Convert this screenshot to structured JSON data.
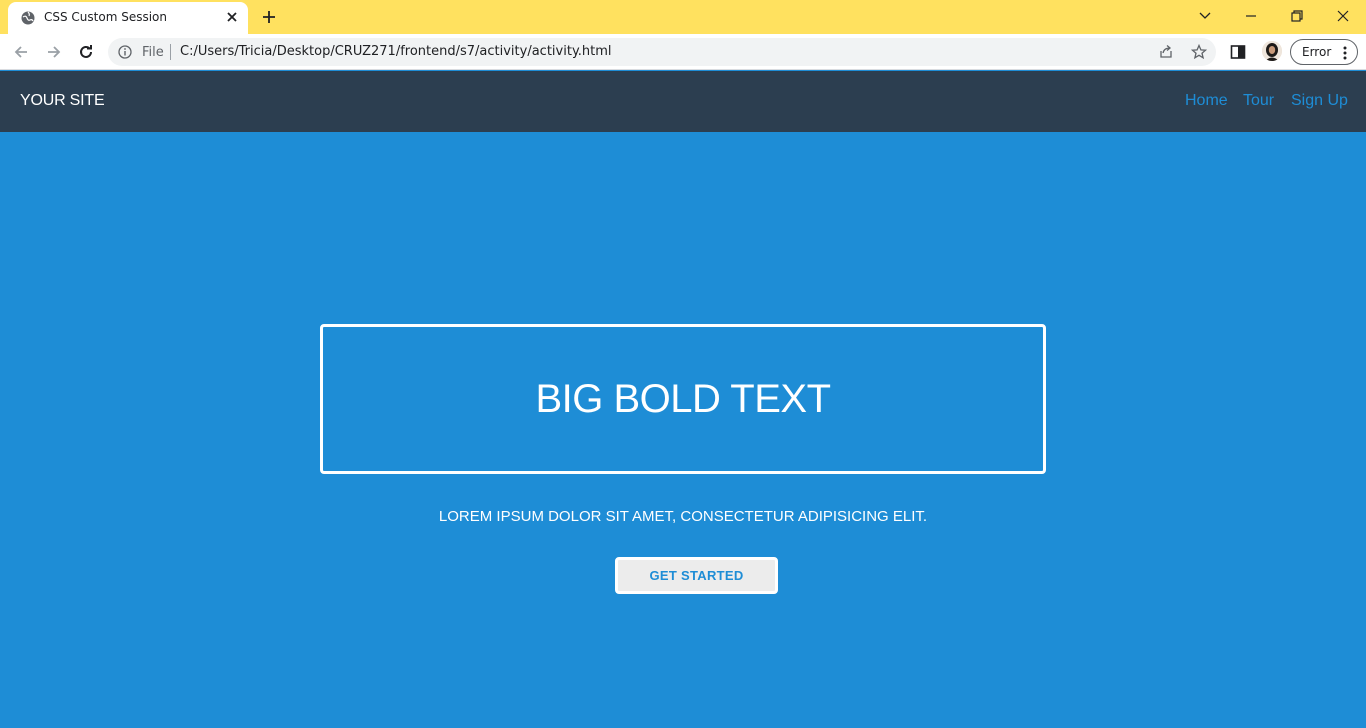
{
  "browser": {
    "tab_title": "CSS Custom Session",
    "scheme_label": "File",
    "url": "C:/Users/Tricia/Desktop/CRUZ271/frontend/s7/activity/activity.html",
    "profile_label": "Error",
    "icons": [
      "globe-icon",
      "close-icon",
      "plus-icon",
      "chevron-down-icon",
      "minimize-icon",
      "restore-icon",
      "close-window-icon",
      "back-icon",
      "forward-icon",
      "reload-icon",
      "info-icon",
      "share-icon",
      "star-icon",
      "side-panel-icon",
      "kebab-menu-icon"
    ]
  },
  "site": {
    "brand": "YOUR SITE",
    "nav": {
      "home": "Home",
      "tour": "Tour",
      "signup": "Sign Up"
    },
    "hero": {
      "headline": "BIG BOLD TEXT",
      "subline": "LOREM IPSUM DOLOR SIT AMET, CONSECTETUR ADIPISICING ELIT.",
      "cta_label": "GET STARTED"
    },
    "colors": {
      "navbar": "#2c3e50",
      "hero": "#1e8dd6",
      "tabstrip": "#ffe15f"
    }
  }
}
